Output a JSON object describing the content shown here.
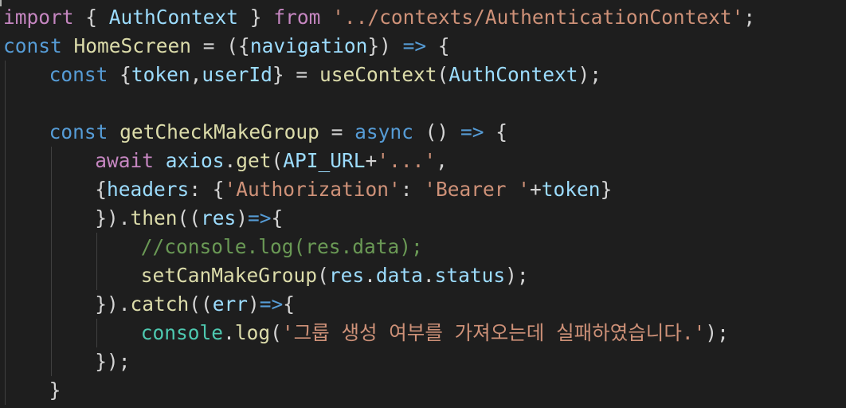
{
  "colors": {
    "background": "#1e1e1e",
    "keyword": "#c586c0",
    "storage": "#569cd6",
    "variable": "#9cdcfe",
    "function": "#dcdcaa",
    "class": "#4ec9b0",
    "string": "#ce9178",
    "comment": "#6a9955",
    "punctuation": "#d4d4d4"
  },
  "code_lines": [
    {
      "indent": 0,
      "tokens": [
        {
          "t": "import",
          "c": "keyword"
        },
        {
          "t": " { ",
          "c": "punct"
        },
        {
          "t": "AuthContext",
          "c": "var"
        },
        {
          "t": " } ",
          "c": "punct"
        },
        {
          "t": "from",
          "c": "keyword"
        },
        {
          "t": " ",
          "c": "punct"
        },
        {
          "t": "'../contexts/AuthenticationContext'",
          "c": "string"
        },
        {
          "t": ";",
          "c": "punct"
        }
      ]
    },
    {
      "indent": 0,
      "tokens": [
        {
          "t": "const",
          "c": "storage"
        },
        {
          "t": " ",
          "c": "punct"
        },
        {
          "t": "HomeScreen",
          "c": "func"
        },
        {
          "t": " = ({",
          "c": "punct"
        },
        {
          "t": "navigation",
          "c": "var"
        },
        {
          "t": "}) ",
          "c": "punct"
        },
        {
          "t": "=>",
          "c": "storage"
        },
        {
          "t": " {",
          "c": "punct"
        }
      ]
    },
    {
      "indent": 4,
      "tokens": [
        {
          "t": "const",
          "c": "storage"
        },
        {
          "t": " {",
          "c": "punct"
        },
        {
          "t": "token",
          "c": "var"
        },
        {
          "t": ",",
          "c": "punct"
        },
        {
          "t": "userId",
          "c": "var"
        },
        {
          "t": "} = ",
          "c": "punct"
        },
        {
          "t": "useContext",
          "c": "func"
        },
        {
          "t": "(",
          "c": "punct"
        },
        {
          "t": "AuthContext",
          "c": "var"
        },
        {
          "t": ");",
          "c": "punct"
        }
      ]
    },
    {
      "indent": 0,
      "tokens": []
    },
    {
      "indent": 4,
      "tokens": [
        {
          "t": "const",
          "c": "storage"
        },
        {
          "t": " ",
          "c": "punct"
        },
        {
          "t": "getCheckMakeGroup",
          "c": "func"
        },
        {
          "t": " = ",
          "c": "punct"
        },
        {
          "t": "async",
          "c": "storage"
        },
        {
          "t": " () ",
          "c": "punct"
        },
        {
          "t": "=>",
          "c": "storage"
        },
        {
          "t": " {",
          "c": "punct"
        }
      ]
    },
    {
      "indent": 8,
      "tokens": [
        {
          "t": "await",
          "c": "keyword"
        },
        {
          "t": " ",
          "c": "punct"
        },
        {
          "t": "axios",
          "c": "var"
        },
        {
          "t": ".",
          "c": "punct"
        },
        {
          "t": "get",
          "c": "func"
        },
        {
          "t": "(",
          "c": "punct"
        },
        {
          "t": "API_URL",
          "c": "var"
        },
        {
          "t": "+",
          "c": "punct"
        },
        {
          "t": "'...'",
          "c": "string"
        },
        {
          "t": ",",
          "c": "punct"
        }
      ]
    },
    {
      "indent": 8,
      "tokens": [
        {
          "t": "{",
          "c": "punct"
        },
        {
          "t": "headers",
          "c": "var"
        },
        {
          "t": ": {",
          "c": "punct"
        },
        {
          "t": "'Authorization'",
          "c": "string"
        },
        {
          "t": ": ",
          "c": "punct"
        },
        {
          "t": "'Bearer '",
          "c": "string"
        },
        {
          "t": "+",
          "c": "punct"
        },
        {
          "t": "token",
          "c": "var"
        },
        {
          "t": "}",
          "c": "punct"
        }
      ]
    },
    {
      "indent": 8,
      "tokens": [
        {
          "t": "}).",
          "c": "punct"
        },
        {
          "t": "then",
          "c": "func"
        },
        {
          "t": "((",
          "c": "punct"
        },
        {
          "t": "res",
          "c": "var"
        },
        {
          "t": ")",
          "c": "punct"
        },
        {
          "t": "=>",
          "c": "storage"
        },
        {
          "t": "{",
          "c": "punct"
        }
      ]
    },
    {
      "indent": 12,
      "tokens": [
        {
          "t": "//console.log(res.data);",
          "c": "comment"
        }
      ]
    },
    {
      "indent": 12,
      "tokens": [
        {
          "t": "setCanMakeGroup",
          "c": "func"
        },
        {
          "t": "(",
          "c": "punct"
        },
        {
          "t": "res",
          "c": "var"
        },
        {
          "t": ".",
          "c": "punct"
        },
        {
          "t": "data",
          "c": "var"
        },
        {
          "t": ".",
          "c": "punct"
        },
        {
          "t": "status",
          "c": "var"
        },
        {
          "t": ");",
          "c": "punct"
        }
      ]
    },
    {
      "indent": 8,
      "tokens": [
        {
          "t": "}).",
          "c": "punct"
        },
        {
          "t": "catch",
          "c": "func"
        },
        {
          "t": "((",
          "c": "punct"
        },
        {
          "t": "err",
          "c": "var"
        },
        {
          "t": ")",
          "c": "punct"
        },
        {
          "t": "=>",
          "c": "storage"
        },
        {
          "t": "{",
          "c": "punct"
        }
      ]
    },
    {
      "indent": 12,
      "tokens": [
        {
          "t": "console",
          "c": "class"
        },
        {
          "t": ".",
          "c": "punct"
        },
        {
          "t": "log",
          "c": "func"
        },
        {
          "t": "(",
          "c": "punct"
        },
        {
          "t": "'그룹 생성 여부를 가져오는데 실패하였습니다.'",
          "c": "string"
        },
        {
          "t": ");",
          "c": "punct"
        }
      ]
    },
    {
      "indent": 8,
      "tokens": [
        {
          "t": "});",
          "c": "punct"
        }
      ]
    },
    {
      "indent": 4,
      "tokens": [
        {
          "t": "}",
          "c": "punct"
        }
      ]
    }
  ]
}
